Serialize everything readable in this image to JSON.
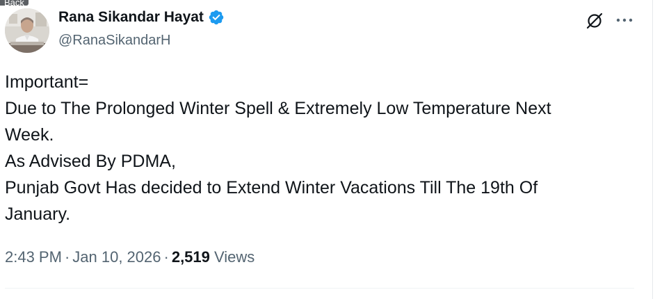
{
  "top_tag": {
    "label": "Back"
  },
  "author": {
    "display_name": "Rana Sikandar Hayat",
    "handle": "@RanaSikandarH",
    "verified_color": "#1d9bf0"
  },
  "actions": {
    "grok_icon": "grok-icon",
    "more_icon": "more-icon"
  },
  "tweet": {
    "lines": [
      "Important=",
      "Due to The Prolonged Winter Spell & Extremely Low Temperature Next",
      "Week.",
      "As Advised By PDMA,",
      "Punjab Govt Has decided to Extend Winter Vacations Till The 19th Of",
      "January."
    ]
  },
  "meta": {
    "time": "2:43 PM",
    "separator": "·",
    "date": "Jan 10, 2026",
    "views_count": "2,519",
    "views_label": "Views"
  }
}
